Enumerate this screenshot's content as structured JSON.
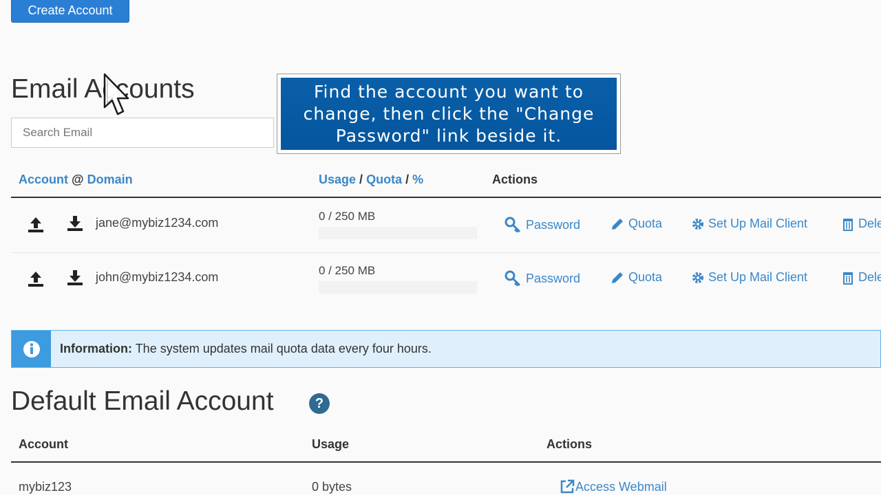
{
  "buttons": {
    "create_account": "Create Account"
  },
  "email_accounts": {
    "title": "Email Accounts",
    "search_placeholder": "Search Email",
    "headers": {
      "account": "Account",
      "at": "@",
      "domain": "Domain",
      "usage": "Usage",
      "slash1": "/",
      "quota": "Quota",
      "slash2": "/",
      "percent": "%",
      "actions": "Actions"
    },
    "rows": [
      {
        "email": "jane@mybiz1234.com",
        "usage": "0 / 250 MB",
        "usage_fraction": 0,
        "actions": {
          "password": "Password",
          "quota": "Quota",
          "setup": "Set Up Mail Client",
          "delete": "Dele"
        }
      },
      {
        "email": "john@mybiz1234.com",
        "usage": "0 / 250 MB",
        "usage_fraction": 0,
        "actions": {
          "password": "Password",
          "quota": "Quota",
          "setup": "Set Up Mail Client",
          "delete": "Dele"
        }
      }
    ]
  },
  "tooltip": {
    "text": "Find the account you want to change, then click the \"Change Password\" link beside it."
  },
  "info_banner": {
    "label": "Information:",
    "message": "The system updates mail quota data every four hours.",
    "icon": "info-icon"
  },
  "default_email": {
    "title": "Default Email Account",
    "help_icon": "?",
    "headers": {
      "account": "Account",
      "usage": "Usage",
      "actions": "Actions"
    },
    "row": {
      "account": "mybiz123",
      "usage": "0 bytes",
      "action": "Access Webmail"
    }
  },
  "colors": {
    "link": "#3a87c8",
    "primary_button": "#2a7fd4",
    "tooltip_bg": "#04569e",
    "info_bg": "#dff0fc",
    "info_accent": "#3d9be0"
  }
}
